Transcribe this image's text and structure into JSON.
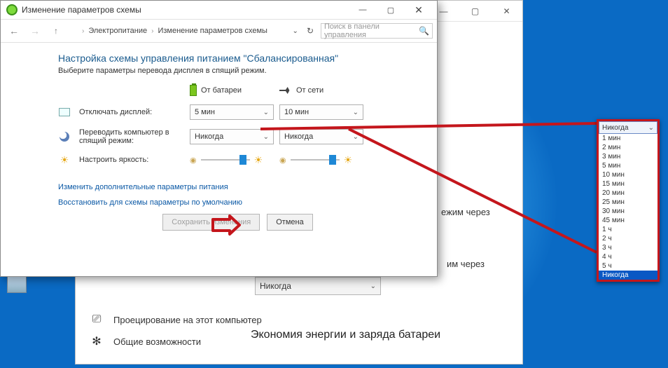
{
  "cpwin": {
    "title": "Изменение параметров схемы",
    "crumb1": "Электропитание",
    "crumb2": "Изменение параметров схемы",
    "search_placeholder": "Поиск в панели управления",
    "heading": "Настройка схемы управления питанием \"Сбалансированная\"",
    "subtext": "Выберите параметры перевода дисплея в спящий режим.",
    "col_battery": "От батареи",
    "col_ac": "От сети",
    "row_display": "Отключать дисплей:",
    "row_sleep": "Переводить компьютер в спящий режим:",
    "row_bright": "Настроить яркость:",
    "display_batt": "5 мин",
    "display_ac": "10 мин",
    "sleep_batt": "Никогда",
    "sleep_ac": "Никогда",
    "link_advanced": "Изменить дополнительные параметры питания",
    "link_restore": "Восстановить для схемы параметры по умолчанию",
    "btn_save": "Сохранить изменения",
    "btn_cancel": "Отмена"
  },
  "bgwin": {
    "right_text1": "ежим через",
    "right_text2": "им через",
    "dropdown_value": "Никогда",
    "opt_project": "Проецирование на этот компьютер",
    "opt_shared": "Общие возможности",
    "section": "Экономия энергии и заряда батареи"
  },
  "popup": {
    "head": "Никогда",
    "items": [
      "1 мин",
      "2 мин",
      "3 мин",
      "5 мин",
      "10 мин",
      "15 мин",
      "20 мин",
      "25 мин",
      "30 мин",
      "45 мин",
      "1 ч",
      "2 ч",
      "3 ч",
      "4 ч",
      "5 ч",
      "Никогда"
    ],
    "selected": "Никогда"
  }
}
